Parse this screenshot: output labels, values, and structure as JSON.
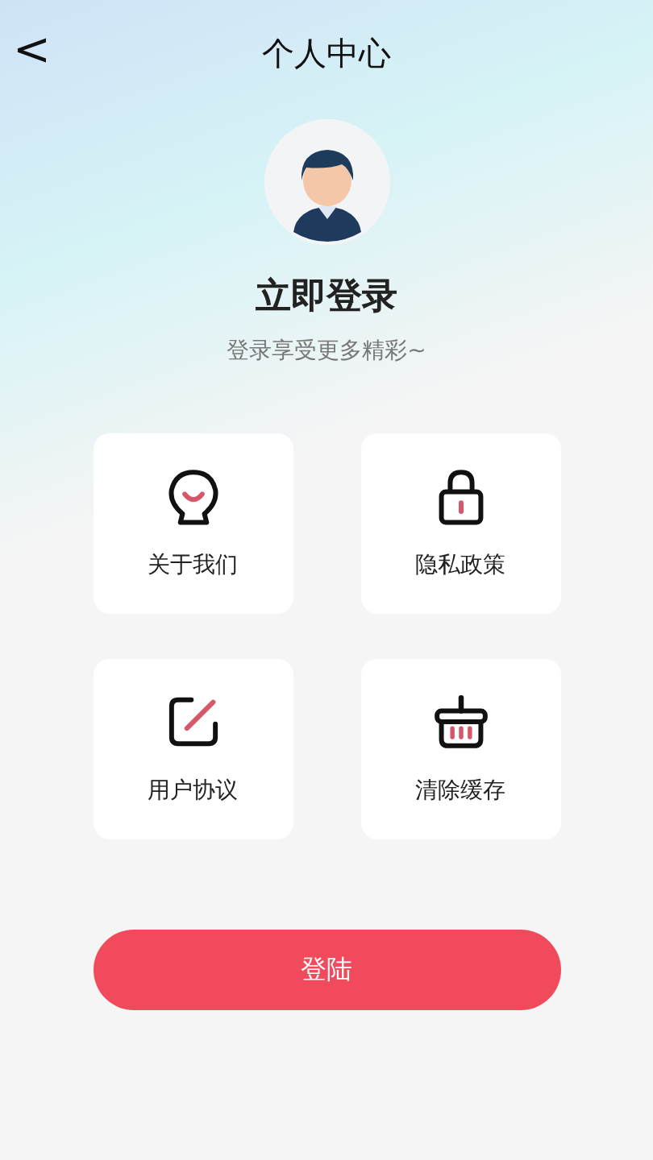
{
  "header": {
    "back": "<",
    "title": "个人中心"
  },
  "profile": {
    "title": "立即登录",
    "subtitle": "登录享受更多精彩~"
  },
  "menu": [
    {
      "kind": "about",
      "label": "关于我们"
    },
    {
      "kind": "privacy",
      "label": "隐私政策"
    },
    {
      "kind": "agreement",
      "label": "用户协议"
    },
    {
      "kind": "cache",
      "label": "清除缓存"
    }
  ],
  "login_button": "登陆"
}
